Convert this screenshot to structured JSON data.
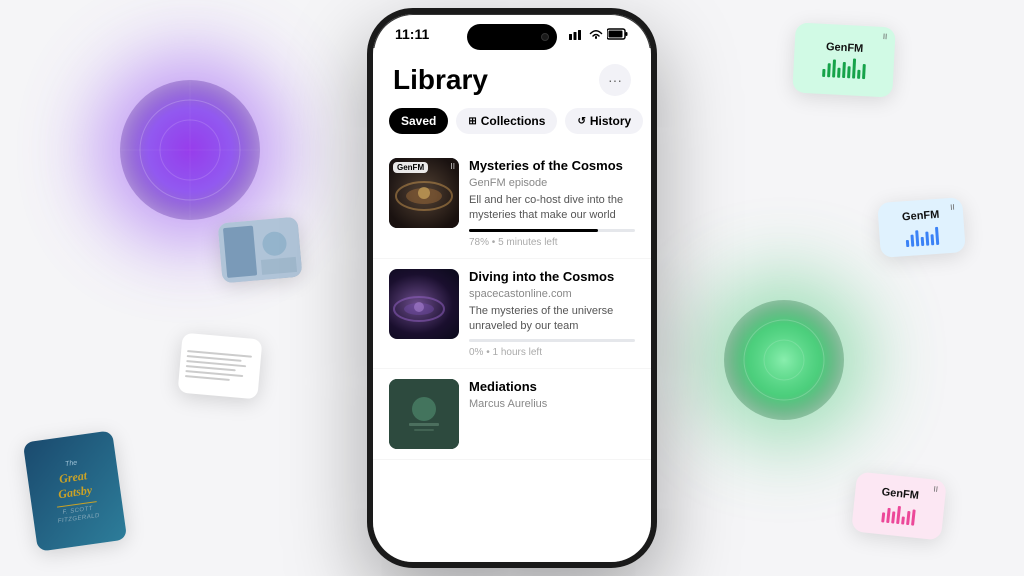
{
  "background": {
    "color": "#f5f5f7"
  },
  "statusBar": {
    "time": "11:11",
    "signal": "▐▌▌",
    "wifi": "WiFi",
    "battery": "⬛"
  },
  "header": {
    "title": "Library",
    "moreLabel": "···"
  },
  "tabs": [
    {
      "id": "saved",
      "label": "Saved",
      "active": true
    },
    {
      "id": "collections",
      "label": "Collections",
      "active": false
    },
    {
      "id": "history",
      "label": "History",
      "active": false
    }
  ],
  "listItems": [
    {
      "id": "item1",
      "title": "Mysteries of the Cosmos",
      "source": "GenFM episode",
      "description": "Ell and her co-host dive into the mysteries that make our world",
      "meta": "78% • 5 minutes left",
      "progress": 78,
      "badge": "GenFM",
      "pauseIcon": "II"
    },
    {
      "id": "item2",
      "title": "Diving into the Cosmos",
      "source": "spacecastonline.com",
      "description": "The mysteries of the universe unraveled by our team",
      "meta": "0% • 1 hours left",
      "progress": 0,
      "badge": null,
      "pauseIcon": null
    },
    {
      "id": "item3",
      "title": "Mediations",
      "source": "Marcus Aurelius",
      "description": "",
      "meta": "",
      "progress": 0,
      "badge": null,
      "pauseIcon": null
    }
  ],
  "floatingCards": {
    "topRight": {
      "label": "GenFM",
      "pause": "II"
    },
    "midRight": {
      "label": "GenFM",
      "pause": "II"
    },
    "bottomRight": {
      "label": "GenFM",
      "pause": "II"
    }
  },
  "bookCard": {
    "title": "The\nGreat\nGatsby"
  }
}
